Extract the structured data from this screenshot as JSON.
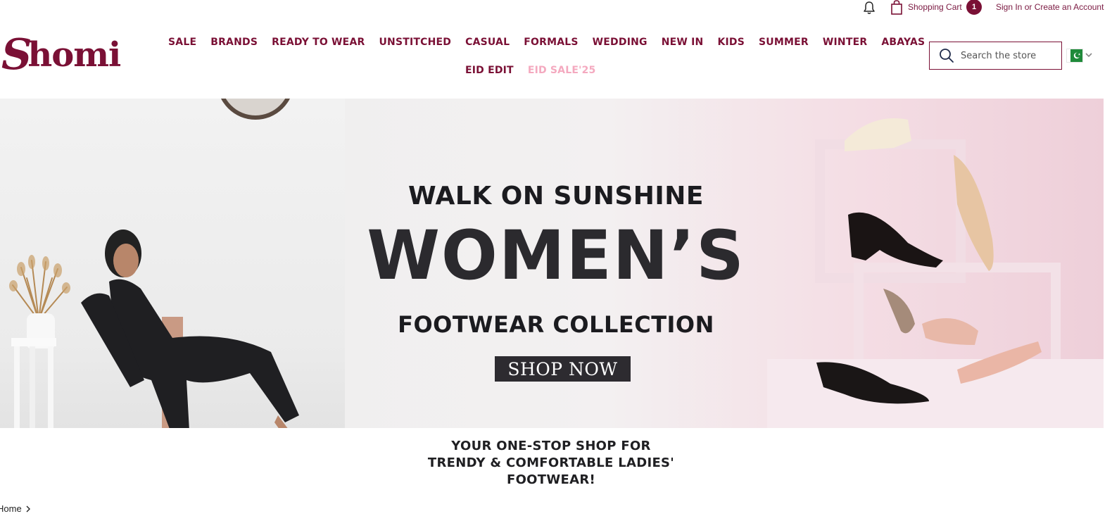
{
  "topbar": {
    "cart_label": "Shopping Cart",
    "cart_count": "1",
    "sign_in": "Sign In",
    "or": " or ",
    "create_account": "Create an Account"
  },
  "brand": {
    "logo_text_initial": "S",
    "logo_text_rest": "homi",
    "brand_color": "#7a1035"
  },
  "nav": {
    "row1": [
      "SALE",
      "BRANDS",
      "READY TO WEAR",
      "UNSTITCHED",
      "CASUAL",
      "FORMALS",
      "WEDDING",
      "NEW IN",
      "KIDS",
      "SUMMER",
      "WINTER",
      "ABAYAS"
    ],
    "row2": [
      "EID EDIT",
      "EID SALE'25"
    ],
    "highlight_color": "#f4a9bf"
  },
  "search": {
    "placeholder": "Search the store"
  },
  "hero": {
    "line1": "WALK ON SUNSHINE",
    "line2": "WOMEN’S",
    "line3": "FOOTWEAR COLLECTION",
    "cta": "SHOP NOW"
  },
  "tagline": {
    "line1": "YOUR ONE-STOP SHOP FOR",
    "line2": "TRENDY & COMFORTABLE LADIES'",
    "line3": "FOOTWEAR!"
  },
  "breadcrumb": {
    "home": "Home"
  },
  "icons": {
    "bell": "bell-icon",
    "cart": "shopping-bag-icon",
    "search": "search-icon",
    "flag": "pakistan-flag-icon",
    "chevron": "chevron-down-icon"
  }
}
